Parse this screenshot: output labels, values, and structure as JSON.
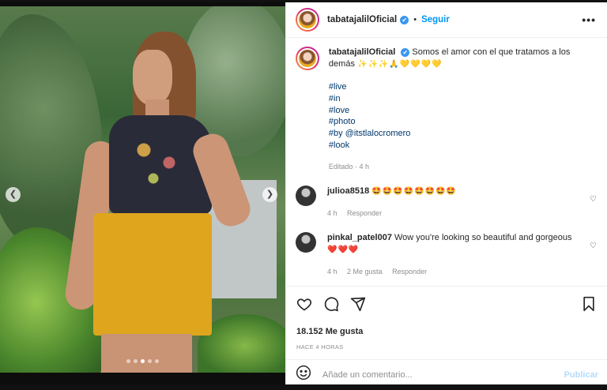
{
  "post": {
    "author": "tabatajalilOficial",
    "follow_label": "Seguir",
    "more": "•••",
    "caption_text": "Somos el amor con el que tratamos a los demás",
    "caption_emojis": "✨✨✨🙏💛💛💛💛",
    "hashtags": [
      "#live",
      "#in",
      "#love",
      "#photo",
      "#by @itstlalocromero",
      "#look"
    ],
    "caption_meta": "Editado · 4 h"
  },
  "comments": [
    {
      "user": "julioa8518",
      "text": "🤩🤩🤩🤩🤩🤩🤩🤩",
      "time": "4 h",
      "likes": "",
      "reply": "Responder"
    },
    {
      "user": "pinkal_patel007",
      "text": "Wow you're looking so beautiful and gorgeous",
      "emojis": "❤️❤️❤️",
      "time": "4 h",
      "likes": "2 Me gusta",
      "reply": "Responder"
    }
  ],
  "stats": {
    "likes": "18.152 Me gusta",
    "ago": "HACE 4 HORAS"
  },
  "composer": {
    "placeholder": "Añade un comentario...",
    "publish": "Publicar"
  },
  "icons": {
    "like": "heart-icon",
    "comment": "comment-icon",
    "share": "share-icon",
    "save": "bookmark-icon",
    "emoji": "emoji-icon",
    "prev": "chevron-left-icon",
    "next": "chevron-right-icon"
  },
  "carousel": {
    "slides": 5,
    "active": 3
  }
}
